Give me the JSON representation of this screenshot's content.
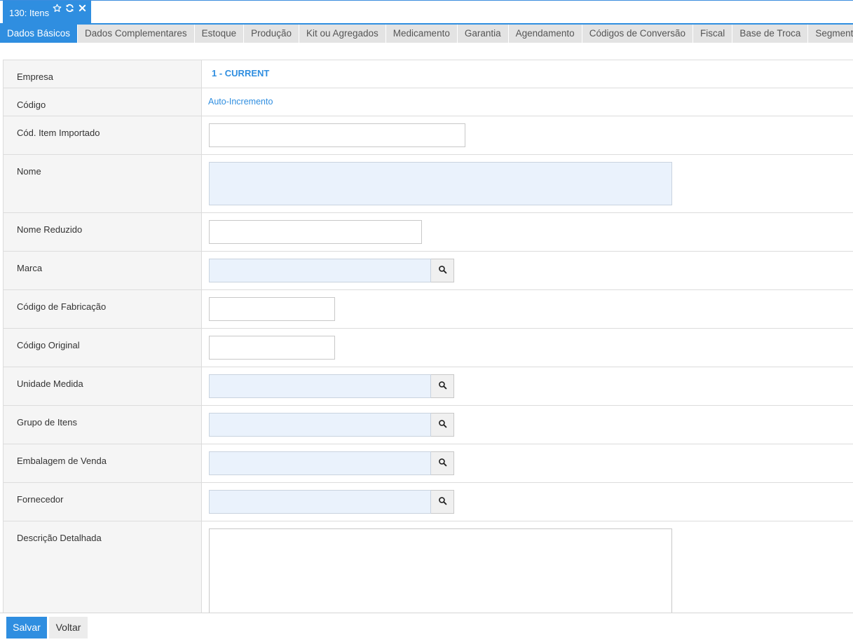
{
  "window_tab": {
    "title": "130: Itens",
    "icons": [
      "star-icon",
      "refresh-icon",
      "close-icon"
    ]
  },
  "tabs": [
    {
      "label": "Dados Básicos",
      "active": true
    },
    {
      "label": "Dados Complementares"
    },
    {
      "label": "Estoque"
    },
    {
      "label": "Produção"
    },
    {
      "label": "Kit ou Agregados"
    },
    {
      "label": "Medicamento"
    },
    {
      "label": "Garantia"
    },
    {
      "label": "Agendamento"
    },
    {
      "label": "Códigos de Conversão"
    },
    {
      "label": "Fiscal"
    },
    {
      "label": "Base de Troca"
    },
    {
      "label": "Segmentos"
    }
  ],
  "form": {
    "empresa": {
      "label": "Empresa",
      "value": "1 - CURRENT"
    },
    "codigo": {
      "label": "Código",
      "value": "Auto-Incremento"
    },
    "cod_item_importado": {
      "label": "Cód. Item Importado",
      "value": ""
    },
    "nome": {
      "label": "Nome",
      "value": ""
    },
    "nome_reduzido": {
      "label": "Nome Reduzido",
      "value": ""
    },
    "marca": {
      "label": "Marca",
      "value": ""
    },
    "codigo_fabricacao": {
      "label": "Código de Fabricação",
      "value": ""
    },
    "codigo_original": {
      "label": "Código Original",
      "value": ""
    },
    "unidade_medida": {
      "label": "Unidade Medida",
      "value": ""
    },
    "grupo_itens": {
      "label": "Grupo de Itens",
      "value": ""
    },
    "embalagem_venda": {
      "label": "Embalagem de Venda",
      "value": ""
    },
    "fornecedor": {
      "label": "Fornecedor",
      "value": ""
    },
    "descricao_detalhada": {
      "label": "Descrição Detalhada",
      "value": ""
    }
  },
  "footer": {
    "save_label": "Salvar",
    "back_label": "Voltar"
  },
  "colors": {
    "accent": "#2f8ee0",
    "required_field_bg": "#eaf2fc",
    "tab_bg": "#e3e3e3",
    "label_bg": "#f5f5f5"
  }
}
